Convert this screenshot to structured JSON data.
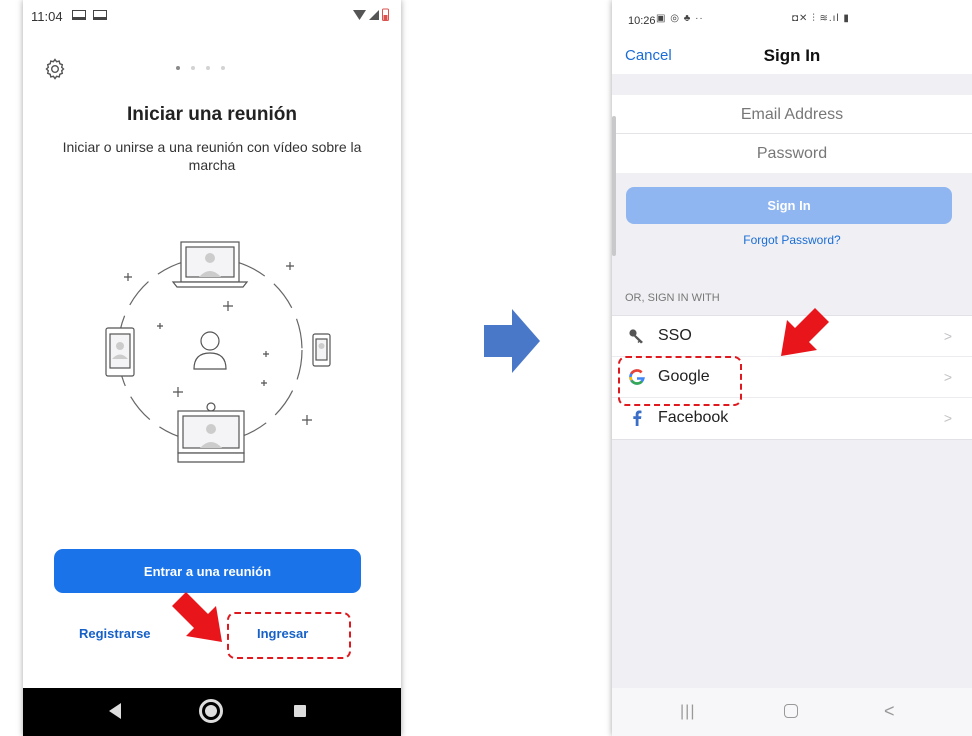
{
  "left_screen": {
    "status_bar": {
      "time": "11:04"
    },
    "title": "Iniciar una reunión",
    "subtitle": "Iniciar o unirse a una reunión con vídeo sobre la marcha",
    "join_button": "Entrar a una reunión",
    "register_link": "Registrarse",
    "login_link": "Ingresar"
  },
  "right_screen": {
    "status_bar": {
      "time": "10:26",
      "left_icons": "▣ ◎ ♣ ··",
      "right_icons": "◘✕ ⫶ ≋.ıl ▮"
    },
    "cancel": "Cancel",
    "title": "Sign In",
    "email_placeholder": "Email Address",
    "password_placeholder": "Password",
    "signin_button": "Sign In",
    "forgot": "Forgot Password?",
    "or_label": "OR, SIGN IN WITH",
    "providers": [
      {
        "label": "SSO",
        "icon": "key-icon"
      },
      {
        "label": "Google",
        "icon": "google-icon"
      },
      {
        "label": "Facebook",
        "icon": "facebook-icon"
      }
    ]
  },
  "colors": {
    "accent_blue": "#1a73e8",
    "link_blue": "#1661c8",
    "highlight_red": "#e0191e",
    "arrow_blue": "#4a78c8"
  }
}
